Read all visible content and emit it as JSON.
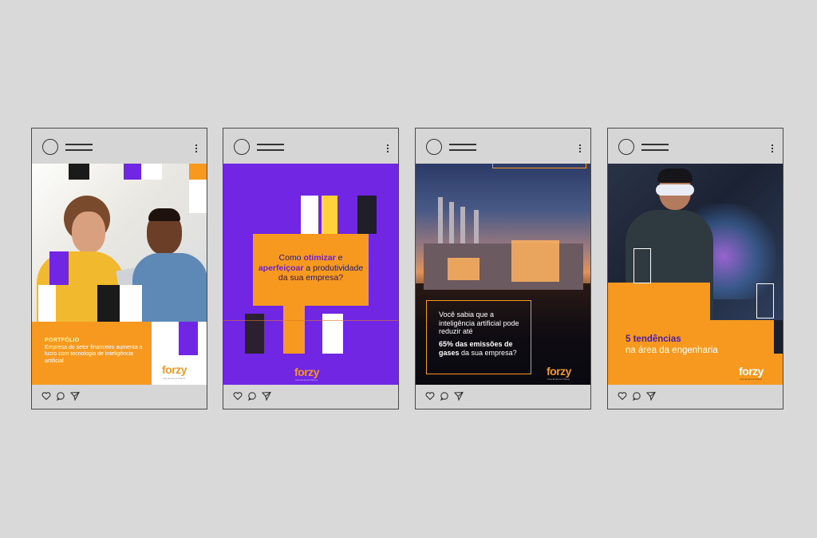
{
  "posts": [
    {
      "tag": "PORTFÓLIO",
      "description": "Empresa do setor financeiro aumenta o lucro com tecnologia de inteligência artificial",
      "logo": "forzy",
      "logo_tagline": "Uma Empresa Pharos"
    },
    {
      "question_1": "Como ",
      "question_bold_1": "otimizar",
      "question_2": " e",
      "question_bold_2": "aperfeiçoar",
      "question_3": " a produtividade da sua empresa?",
      "logo": "forzy",
      "logo_tagline": "Uma Empresa Pharos"
    },
    {
      "text_1": "Você sabia que a inteligência artificial pode reduzir até",
      "text_bold": "65% das emissões de gases",
      "text_2": " da sua empresa?",
      "logo": "forzy",
      "logo_tagline": "Uma Empresa Pharos"
    },
    {
      "title_bold": "5 tendências",
      "title_rest": "na área da engenharia",
      "logo": "forzy",
      "logo_tagline": "Uma Empresa Pharos"
    }
  ],
  "icons": [
    "heart-icon",
    "comment-icon",
    "share-icon",
    "more-icon",
    "avatar"
  ],
  "colors": {
    "orange": "#f6991e",
    "purple": "#7126e4",
    "background": "#d9d9d9"
  }
}
